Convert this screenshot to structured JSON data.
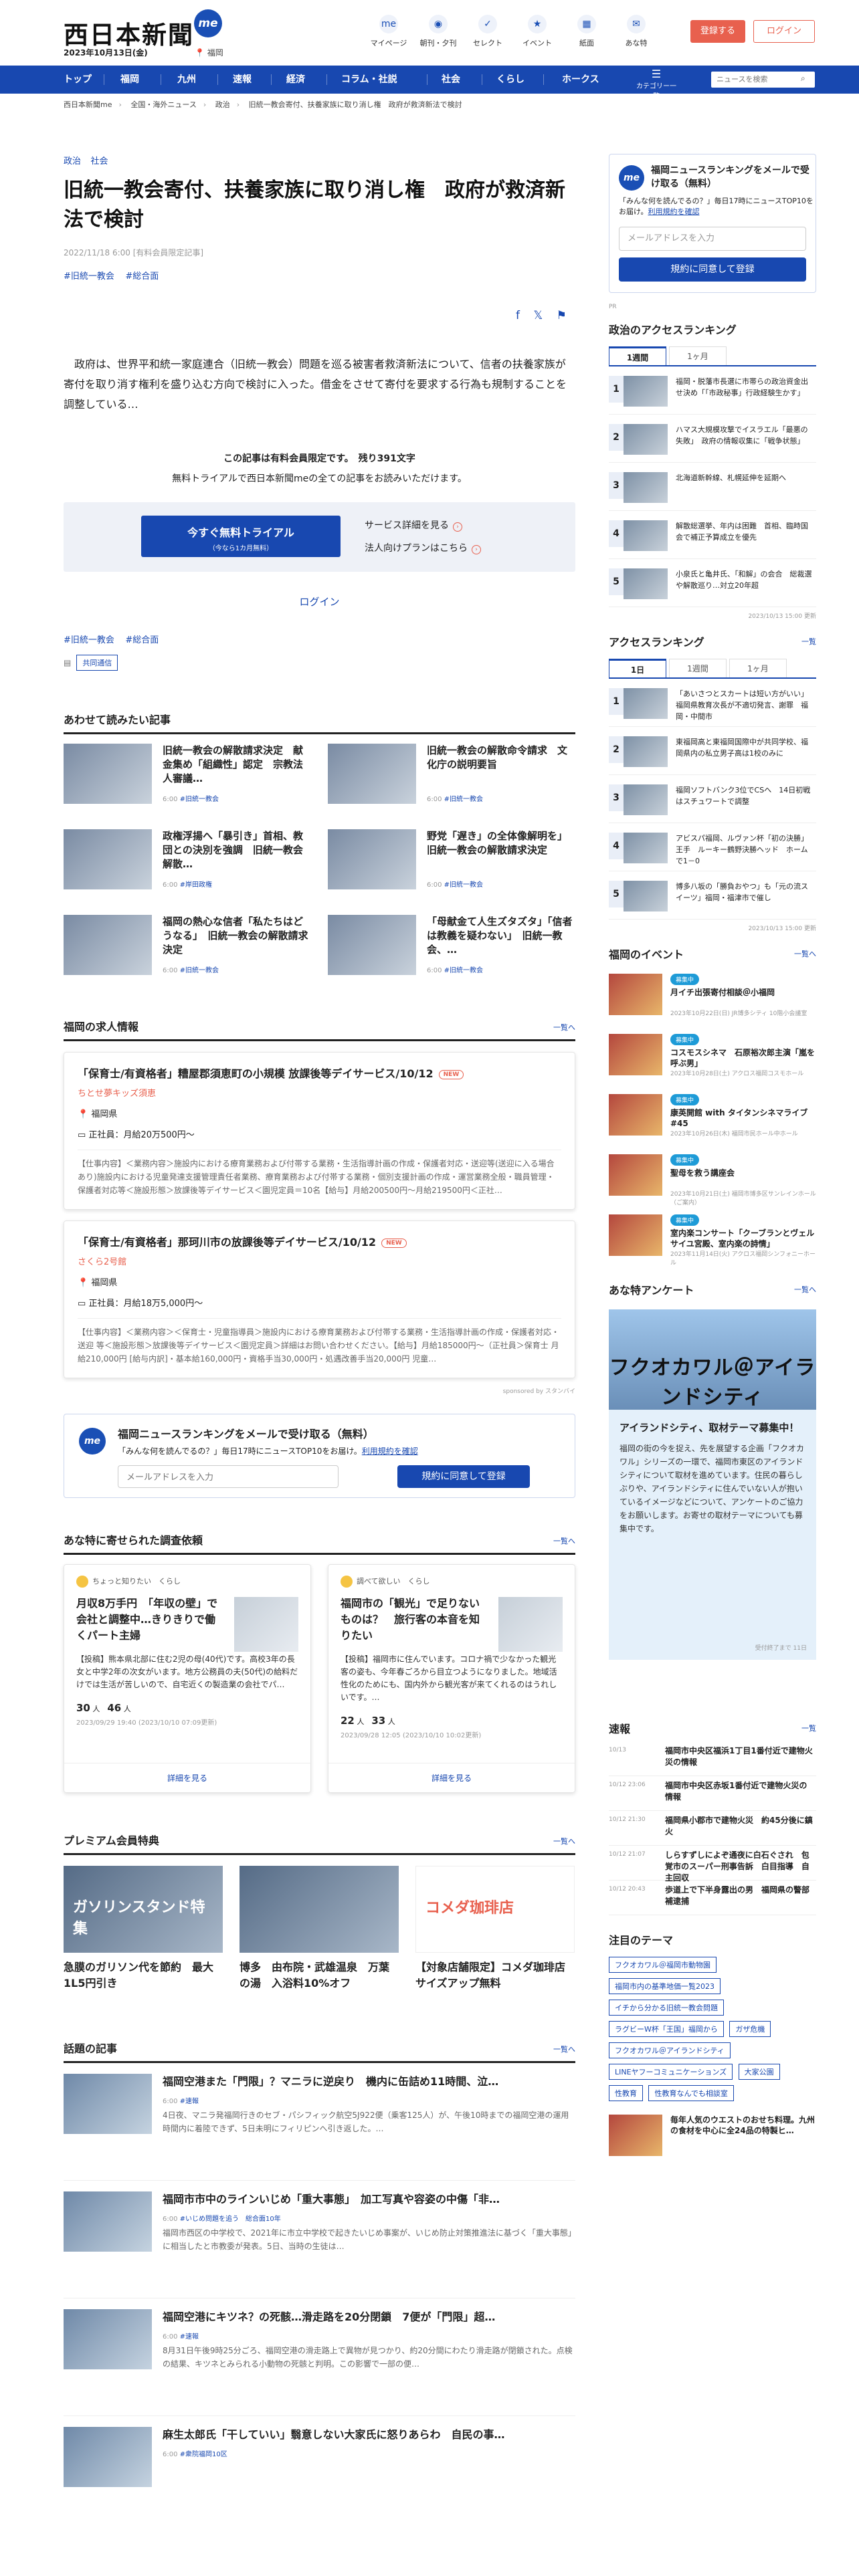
{
  "header": {
    "logo": "西日本新聞",
    "me": "me",
    "date": "2023年10月13日(金)",
    "region": "福岡",
    "icons": [
      {
        "label": "マイページ",
        "glyph": "me"
      },
      {
        "label": "朝刊・夕刊",
        "glyph": "◉"
      },
      {
        "label": "セレクト",
        "glyph": "✓"
      },
      {
        "label": "イベント",
        "glyph": "★"
      },
      {
        "label": "紙面",
        "glyph": "▦"
      },
      {
        "label": "あな特",
        "glyph": "✉"
      }
    ],
    "register": "登録する",
    "login": "ログイン"
  },
  "nav": {
    "items": [
      "トップ",
      "福岡",
      "九州",
      "速報",
      "経済",
      "コラム・社説",
      "社会",
      "くらし",
      "ホークス"
    ],
    "menu": "カテゴリー一覧",
    "search_placeholder": "ニュースを検索"
  },
  "breadcrumb": [
    "西日本新聞me",
    "全国・海外ニュース",
    "政治",
    "旧統一教会寄付、扶養家族に取り消し権　政府が救済新法で検討"
  ],
  "article": {
    "cats": [
      "政治",
      "社会"
    ],
    "title": "旧統一教会寄付、扶養家族に取り消し権　政府が救済新法で検討",
    "meta": "2022/11/18 6:00 [有料会員限定記事]",
    "tags": [
      "#旧統一教会",
      "#総合面"
    ],
    "lead": "政府は、世界平和統一家庭連合（旧統一教会）問題を巡る被害者救済新法について、信者の扶養家族が寄付を取り消す権利を盛り込む方向で検討に入った。借金をさせて寄付を要求する行為も規制することを調整している…",
    "pay_title": "この記事は有料会員限定です。　残り391文字",
    "pay_sub": "無料トライアルで西日本新聞meの全ての記事をお読みいただけます。",
    "trial": "今すぐ無料トライアル",
    "trial_sub": "（今なら1カ月無料）",
    "service": "サービス詳細を見る",
    "corp": "法人向けプランはこちら",
    "login": "ログイン",
    "source": "共同通信"
  },
  "related": {
    "title": "あわせて読みたい記事",
    "items": [
      {
        "title": "旧統一教会の解散請求決定　献金集め「組織性」認定　宗教法人審議…",
        "date": "6:00",
        "tag": "#旧統一教会"
      },
      {
        "title": "旧統一教会の解散命令請求　文化庁の説明要旨",
        "date": "6:00",
        "tag": "#旧統一教会"
      },
      {
        "title": "政権浮揚へ「暴引き」首相、教団との決別を強調　旧統一教会解散…",
        "date": "6:00",
        "tag": "#岸田政権"
      },
      {
        "title": "野党「遅き」の全体像解明を」 旧統一教会の解散請求決定",
        "date": "6:00",
        "tag": "#旧統一教会"
      },
      {
        "title": "福岡の熱心な信者「私たちはどうなる」　旧統一教会の解散請求決定",
        "date": "6:00",
        "tag": "#旧統一教会"
      },
      {
        "title": "「母献金て人生ズタズタ」「信者は教義を疑わない」　旧統一教会、…",
        "date": "6:00",
        "tag": "#旧統一教会"
      }
    ]
  },
  "jobs": {
    "title": "福岡の求人情報",
    "more": "一覧へ",
    "items": [
      {
        "title": "「保育士/有資格者」糟屋郡須恵町の小規模 放課後等デイサービス/10/12",
        "new": "NEW",
        "company": "ちとせ夢キッズ須恵",
        "loc": "福岡県",
        "pay": "正社員：月給20万500円〜",
        "desc": "【仕事内容】＜業務内容＞施設内における療育業務および付帯する業務・生活指導計画の作成・保護者対応・送迎等(送迎に入る場合あり)施設内における児童発達支援管理責任者業務、療育業務および付帯する業務・個別支援計画の作成・運営業務全般・職員管理・保護者対応等＜施設形態＞放課後等デイサービス＜園児定員＝10名【給与】月給200500円〜月給219500円＜正社…"
      },
      {
        "title": "「保育士/有資格者」那珂川市の放課後等デイサービス/10/12",
        "new": "NEW",
        "company": "さくら2号館",
        "loc": "福岡県",
        "pay": "正社員：月給18万5,000円〜",
        "desc": "【仕事内容】＜業務内容＞＜保育士・児童指導員＞施設内における療育業務および付帯する業務・生活指導計画の作成・保護者対応・送迎 等＜施設形態＞放課後等デイサービス＜園児定員＞詳細はお問い合わせください。【給与】月給185000円〜（正社員＞保育士 月給210,000円 [給与内訳]・基本給160,000円・資格手当30,000円・処遇改善手当20,000円 児童…"
      }
    ],
    "sponsor": "sponsored by スタンバイ"
  },
  "newsletter": {
    "title": "福岡ニュースランキングをメールで受け取る（無料）",
    "sub": "「みんな何を読んでるの？」毎日17時にニュースTOP10をお届け。",
    "terms": "利用規約を確認",
    "placeholder": "メールアドレスを入力",
    "button": "規約に同意して登録"
  },
  "surveys": {
    "title": "あな特に寄せられた調査依頼",
    "more": "一覧へ",
    "items": [
      {
        "who": "ちょっと知りたい",
        "cat": "くらし",
        "title": "月収8万手円　「年収の壁」で会社と調整中…きりきりで働くパート主婦",
        "desc": "【投稿】熊本県北部に住む2児の母(40代)です。高校3年の長女と中学2年の次女がいます。地方公務員の夫(50代)の給料だけでは生活が苦しいので、自宅近くの製造業の会社でパ…",
        "v1": "30",
        "v2": "46",
        "date": "2023/09/29 19:40 (2023/10/10 07:09更新)",
        "link": "詳細を見る"
      },
      {
        "who": "調べて欲しい",
        "cat": "くらし",
        "title": "福岡市の「観光」で足りないものは？　旅行客の本音を知りたい",
        "desc": "【投稿】福岡市に住んでいます。コロナ禍で少なかった観光客の姿も、今年春ごろから目立つようになりました。地域活性化のためにも、国内外から観光客が来てくれるのはうれしいです。…",
        "v1": "22",
        "v2": "33",
        "date": "2023/09/28 12:05 (2023/10/10 10:02更新)",
        "link": "詳細を見る"
      }
    ]
  },
  "premium": {
    "title": "プレミアム会員特典",
    "more": "一覧へ",
    "items": [
      {
        "title": "急膜のガリソン代を節約　最大1L5円引き",
        "img": "ガソリンスタンド特集"
      },
      {
        "title": "博多　由布院・武雄温泉　万葉の湯　入浴料10%オフ",
        "img": ""
      },
      {
        "title": "【対象店舗限定】コメダ珈琲店 サイズアップ無料",
        "img": "コメダ珈琲店"
      }
    ]
  },
  "topics": {
    "title": "話題の記事",
    "more": "一覧へ",
    "items": [
      {
        "title": "福岡空港また「門限」？マニラに逆戻り　機内に缶詰め11時間、泣…",
        "date": "6:00",
        "tag": "#速報",
        "desc": "4日夜、マニラ発福岡行きのセブ・パシフィック航空5J922便（乗客125人）が、午後10時までの福岡空港の運用時間内に着陸できず、5日未明にフィリピンへ引き返した。…"
      },
      {
        "title": "福岡市市中のラインいじめ「重大事態」　加工写真や容姿の中傷「非…",
        "date": "6:00",
        "tag": "#いじめ問題を追う　総合面10年",
        "desc": "福岡市西区の中学校で、2021年に市立中学校で起きたいじめ事案が、いじめ防止対策推進法に基づく「重大事態」に相当したと市教委が発表。5日、当時の生徒は…"
      },
      {
        "title": "福岡空港にキツネ？の死骸…滑走路を20分閉鎖　7便が「門限」超…",
        "date": "6:00",
        "tag": "#速報",
        "desc": "8月31日午後9時25分ごろ、福岡空港の滑走路上で異物が見つかり、約20分間にわたり滑走路が閉鎖された。点検の結果、キツネとみられる小動物の死骸と判明。この影響で一部の便…"
      },
      {
        "title": "麻生太郎氏「干していい」翳意しない大家氏に怒りあらわ　自民の事…",
        "date": "6:00",
        "tag": "#衆院福岡10区",
        "desc": ""
      }
    ]
  },
  "side": {
    "nl": {
      "title": "福岡ニュースランキングをメールで受け取る（無料）",
      "sub": "「みんな何を読んでるの？」毎日17時にニュースTOP10をお届け。",
      "terms": "利用規約を確認",
      "placeholder": "メールアドレスを入力",
      "button": "規約に同意して登録",
      "ad": "PR"
    },
    "politics": {
      "title": "政治のアクセスランキング",
      "tabs": [
        "1週間",
        "1ヶ月"
      ],
      "items": [
        "福岡・脱藩市長選に市帯らの政治資金出せ決め「「市政秘事」行政経験生かす」",
        "ハマス大規模攻撃でイスラエル「最悪の失敗」　政府の情報収集に「戦争状態」",
        "北海道新幹線、札幌延伸を延期へ",
        "解散総選挙、年内は困難　首相、臨時国会で補正予算成立を優先",
        "小泉氏と亀井氏、「和解」の会合　総裁選や解散巡り…対立20年超"
      ],
      "date": "2023/10/13 15:00 更新"
    },
    "access": {
      "title": "アクセスランキング",
      "more": "一覧",
      "tabs": [
        "1日",
        "1週間",
        "1ヶ月"
      ],
      "items": [
        "「あいさつとスカートは短い方がいい」福岡県教育次長が不適切発言、謝罪　福岡・中間市",
        "東福岡高と東福岡国際中が共同学校、福岡県内の私立男子高は1校のみに",
        "福岡ソフトバンク3位でCSへ　14日初戦はスチュワートで調整",
        "アビスパ福岡、ルヴァン杯「初の決勝」王手　ルーキー鶴野決勝ヘッド　ホームで1－0",
        "博多八坂の「勝負おやつ」も「元の流スイーツ」福岡・福津市で催し"
      ],
      "date": "2023/10/13 15:00 更新"
    },
    "events": {
      "title": "福岡のイベント",
      "more": "一覧へ",
      "badge": "募集中",
      "items": [
        {
          "title": "月イチ出張寄付相談＠小福岡",
          "date": "2023年10月22日(日)\nJR博多シティ 10階小会議室"
        },
        {
          "title": "コスモスシネマ　石原裕次郎主演「嵐を呼ぶ男」",
          "date": "2023年10月28日(土)\nアクロス福岡コスモホール"
        },
        {
          "title": "康英開館 with タイタンシネマライブ#45",
          "date": "2023年10月26日(木)\n福岡市民ホール中ホール"
        },
        {
          "title": "聖母を救う講座会",
          "date": "2023年10月21日(土)\n福岡市博多区サンレインホール（ご案内）"
        },
        {
          "title": "室内楽コンサート「クーブランとヴェルサイユ宮殿、室内楽の詩情」",
          "date": "2023年11月14日(火)\nアクロス福岡シンフォニーホール"
        }
      ]
    },
    "anq": {
      "title": "あな特アンケート",
      "more": "一覧へ",
      "banner": "フクオカワル＠アイランドシティ",
      "head": "アイランドシティ、取材テーマ募集中！",
      "desc": "福岡の街の今を捉え、先を展望する企画「フクオカワル」シリーズの一環で、福岡市東区のアイランドシティについて取材を進めています。住民の暮らしぶりや、アイランドシティに住んでいない人が抱いているイメージなどについて、アンケートのご協力をお願いします。お寄せの取材テーマについても募集中です。",
      "date": "受付終了まで 11日"
    },
    "breaking": {
      "title": "速報",
      "more": "一覧",
      "items": [
        {
          "time": "10/13",
          "title": "福岡市中央区福浜1丁目1番付近で建物火災の情報"
        },
        {
          "time": "10/12 23:06",
          "title": "福岡市中央区赤坂1番付近で建物火災の情報"
        },
        {
          "time": "10/12 21:30",
          "title": "福岡県小郡市で建物火災　約45分後に鎮火"
        },
        {
          "time": "10/12 21:07",
          "title": "しらすずしによぞ通夜に白石ぐされ　包覚市のスーパー刑事告訴　白目指導　自主回収"
        },
        {
          "time": "10/12 20:43",
          "title": "歩道上で下半身露出の男　福岡県の警部補逮捕"
        }
      ]
    },
    "themes": {
      "title": "注目のテーマ",
      "items": [
        "フクオカワル＠福岡市動物園",
        "福岡市内の基準地価一覧2023",
        "イチから分かる旧統一教会問題",
        "ラグビーW杯「王国」福岡から",
        "ガザ危機",
        "フクオカワル＠アイランドシティ",
        "LINEヤフーコミュニケーションズ",
        "大家公園",
        "性教育",
        "性教育なんでも相談室"
      ]
    },
    "last": {
      "title": "毎年人気のウエストのおせち料理。九州の食材を中心に全24品の特製ヒ…"
    }
  }
}
